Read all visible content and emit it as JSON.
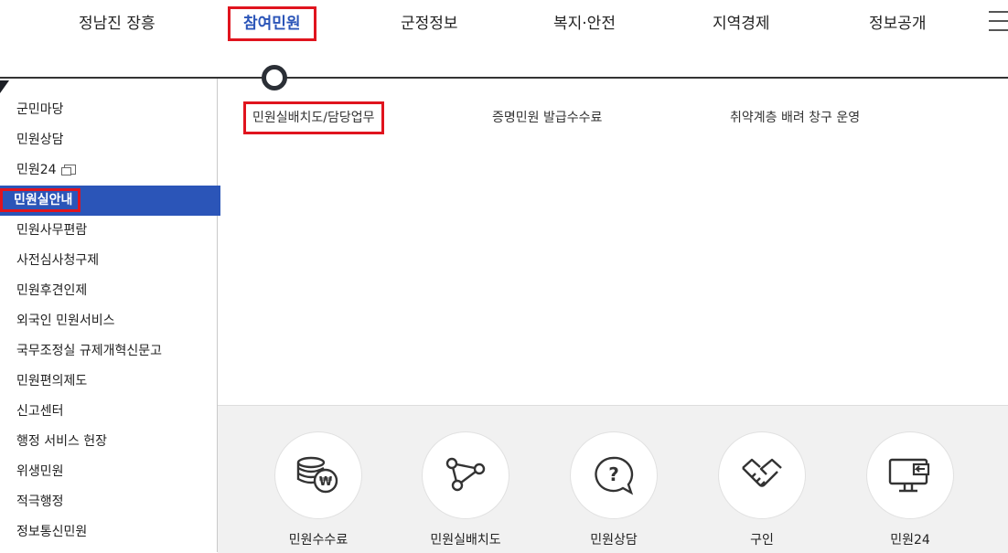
{
  "nav": {
    "items": [
      {
        "label": "정남진 장흥"
      },
      {
        "label": "참여민원"
      },
      {
        "label": "군정정보"
      },
      {
        "label": "복지·안전"
      },
      {
        "label": "지역경제"
      },
      {
        "label": "정보공개"
      }
    ],
    "menu_icon": "hamburger-icon"
  },
  "sidebar": {
    "items": [
      {
        "label": "군민마당"
      },
      {
        "label": "민원상담"
      },
      {
        "label": "민원24"
      },
      {
        "label": "민원실안내"
      },
      {
        "label": "민원사무편람"
      },
      {
        "label": "사전심사청구제"
      },
      {
        "label": "민원후견인제"
      },
      {
        "label": "외국인 민원서비스"
      },
      {
        "label": "국무조정실 규제개혁신문고"
      },
      {
        "label": "민원편의제도"
      },
      {
        "label": "신고센터"
      },
      {
        "label": "행정 서비스 헌장"
      },
      {
        "label": "위생민원"
      },
      {
        "label": "적극행정"
      },
      {
        "label": "정보통신민원"
      }
    ]
  },
  "submenu": {
    "items": [
      {
        "label": "민원실배치도/담당업무"
      },
      {
        "label": "증명민원 발급수수료"
      },
      {
        "label": "취약계층 배려 창구 운영"
      }
    ]
  },
  "services": {
    "items": [
      {
        "label": "민원수수료",
        "icon": "coins-won-icon"
      },
      {
        "label": "민원실배치도",
        "icon": "node-graph-icon"
      },
      {
        "label": "민원상담",
        "icon": "question-bubble-icon"
      },
      {
        "label": "구인",
        "icon": "handshake-icon"
      },
      {
        "label": "민원24",
        "icon": "monitor-icon"
      }
    ]
  },
  "colors": {
    "accent": "#2b55b8",
    "highlight": "#e0141e",
    "panel": "#f1f1f1"
  }
}
